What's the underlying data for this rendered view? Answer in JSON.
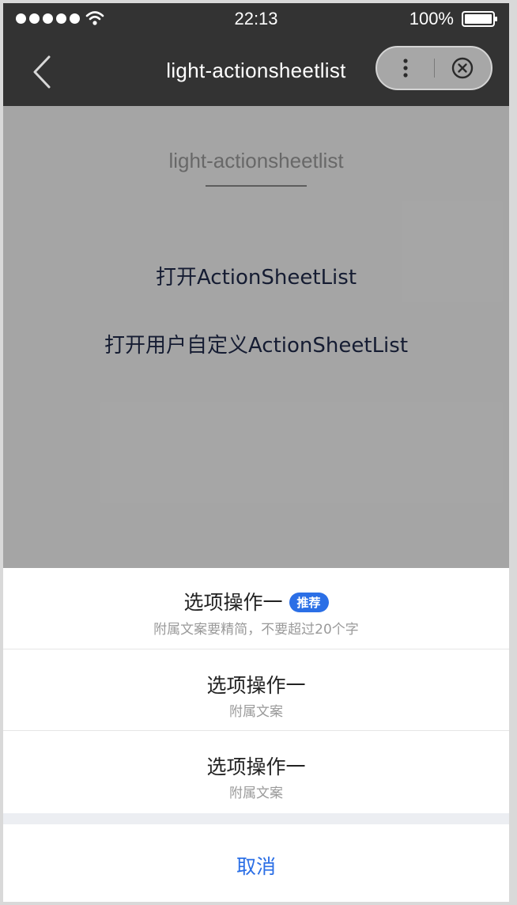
{
  "status_bar": {
    "time": "22:13",
    "battery_percent": "100%"
  },
  "nav_bar": {
    "title": "light-actionsheetlist"
  },
  "page": {
    "title": "light-actionsheetlist",
    "links": [
      "打开ActionSheetList",
      "打开用户自定义ActionSheetList"
    ]
  },
  "action_sheet": {
    "items": [
      {
        "label": "选项操作一",
        "badge": "推荐",
        "subtitle": "附属文案要精简，不要超过20个字"
      },
      {
        "label": "选项操作一",
        "subtitle": "附属文案"
      },
      {
        "label": "选项操作一",
        "subtitle": "附属文案"
      }
    ],
    "cancel_label": "取消"
  },
  "colors": {
    "nav_bg": "#333333",
    "accent": "#2b6fe6",
    "overlay": "rgba(0,0,0,0.32)"
  },
  "icons": {
    "back": "chevron-left-icon",
    "more": "more-vertical-icon",
    "close": "close-circle-icon",
    "wifi": "wifi-icon",
    "battery": "battery-icon",
    "signal": "signal-dots-icon"
  }
}
